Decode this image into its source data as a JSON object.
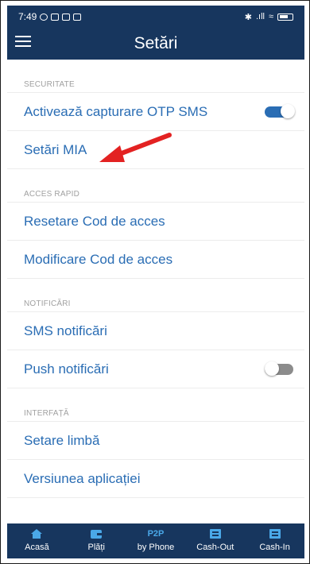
{
  "status": {
    "time": "7:49",
    "signal": ".ıll"
  },
  "header": {
    "title": "Setări"
  },
  "sections": [
    {
      "title": "SECURITATE",
      "rows": [
        {
          "label": "Activează capturare OTP SMS",
          "toggle": "on"
        },
        {
          "label": "Setări MIA"
        }
      ]
    },
    {
      "title": "ACCES RAPID",
      "rows": [
        {
          "label": "Resetare Cod de acces"
        },
        {
          "label": "Modificare Cod de acces"
        }
      ]
    },
    {
      "title": "NOTIFICĂRI",
      "rows": [
        {
          "label": "SMS notificări"
        },
        {
          "label": "Push notificări",
          "toggle": "off"
        }
      ]
    },
    {
      "title": "INTERFAȚĂ",
      "rows": [
        {
          "label": "Setare limbă"
        },
        {
          "label": "Versiunea aplicației"
        }
      ]
    }
  ],
  "tabbar": {
    "tabs": [
      {
        "label": "Acasă",
        "icon": "home-icon"
      },
      {
        "label": "Plăți",
        "icon": "wallet-icon"
      },
      {
        "label": "by Phone",
        "icon_text": "P2P"
      },
      {
        "label": "Cash-Out",
        "icon": "atm-icon"
      },
      {
        "label": "Cash-In",
        "icon": "atm-icon"
      }
    ]
  },
  "colors": {
    "primary": "#17365e",
    "accent": "#2a6db4",
    "arrow": "#e32222"
  }
}
